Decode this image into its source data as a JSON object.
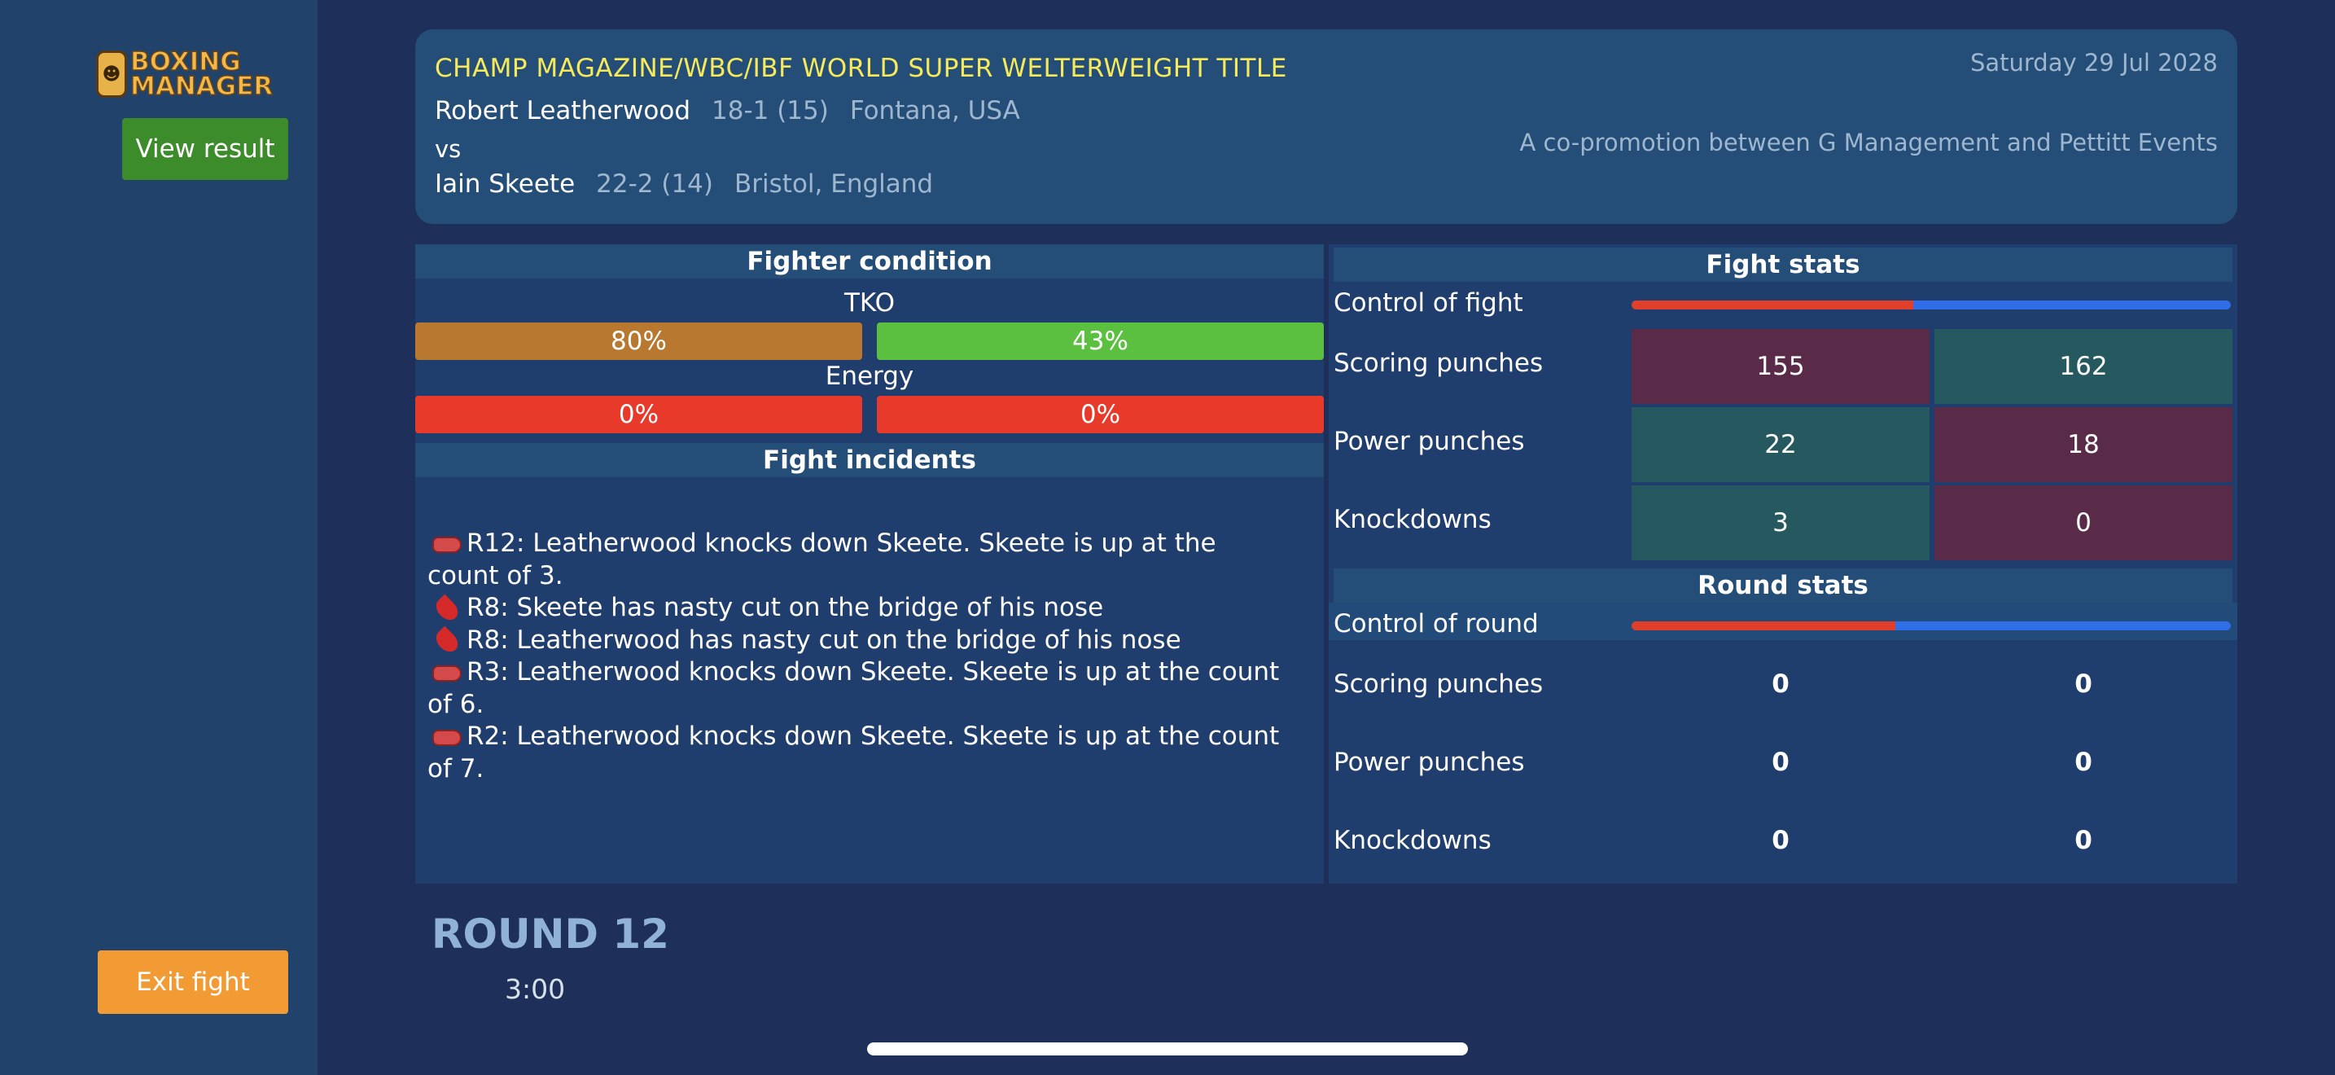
{
  "app": {
    "logo_line1": "BOXING",
    "logo_line2": "MANAGER",
    "view_result": "View result",
    "exit_fight": "Exit fight"
  },
  "header": {
    "title": "CHAMP MAGAZINE/WBC/IBF WORLD SUPER WELTERWEIGHT TITLE",
    "date": "Saturday 29 Jul 2028",
    "promotion": "A co-promotion between G Management and Pettitt Events",
    "vs": "vs",
    "fighter1": {
      "name": "Robert Leatherwood",
      "record": "18-1 (15)",
      "location": "Fontana, USA"
    },
    "fighter2": {
      "name": "Iain Skeete",
      "record": "22-2 (14)",
      "location": "Bristol, England"
    }
  },
  "condition": {
    "heading": "Fighter condition",
    "tko_label": "TKO",
    "tko": [
      "80%",
      "43%"
    ],
    "energy_label": "Energy",
    "energy": [
      "0%",
      "0%"
    ]
  },
  "incidents": {
    "heading": "Fight incidents",
    "items": [
      {
        "icon": "boxing-glove-icon",
        "text": "R12: Leatherwood knocks down Skeete. Skeete is up at the count of 3."
      },
      {
        "icon": "blood-drop-icon",
        "text": "R8: Skeete has nasty cut on the bridge of his nose"
      },
      {
        "icon": "blood-drop-icon",
        "text": "R8: Leatherwood has nasty cut on the bridge of his nose"
      },
      {
        "icon": "boxing-glove-icon",
        "text": "R3: Leatherwood knocks down Skeete. Skeete is up at the count of 6."
      },
      {
        "icon": "boxing-glove-icon",
        "text": "R2: Leatherwood knocks down Skeete. Skeete is up at the count of 7."
      }
    ]
  },
  "fight_stats": {
    "heading": "Fight stats",
    "control_label": "Control of fight",
    "control_red_fraction": 0.47,
    "rows": [
      {
        "label": "Scoring punches",
        "values": [
          "155",
          "162"
        ]
      },
      {
        "label": "Power punches",
        "values": [
          "22",
          "18"
        ]
      },
      {
        "label": "Knockdowns",
        "values": [
          "3",
          "0"
        ]
      }
    ]
  },
  "round_stats": {
    "heading": "Round stats",
    "control_label": "Control of round",
    "control_red_fraction": 0.44,
    "rows": [
      {
        "label": "Scoring punches",
        "values": [
          "0",
          "0"
        ]
      },
      {
        "label": "Power punches",
        "values": [
          "0",
          "0"
        ]
      },
      {
        "label": "Knockdowns",
        "values": [
          "0",
          "0"
        ]
      }
    ]
  },
  "round": {
    "title": "ROUND 12",
    "time": "3:00"
  },
  "colors": {
    "background": "#1e2f5a",
    "sidebar": "#21426b",
    "title_yellow": "#f6ea5a",
    "tko_fighter1": "#b87830",
    "tko_fighter2": "#5bc040",
    "energy": "#e83a2a",
    "view_result_green": "#3c8c2b",
    "exit_orange": "#f29a34"
  }
}
